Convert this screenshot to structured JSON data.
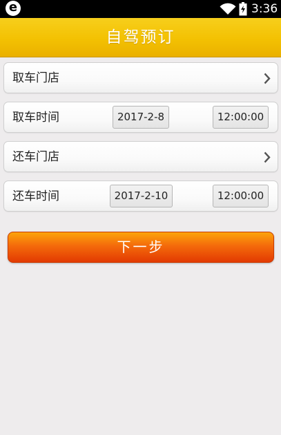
{
  "status_bar": {
    "app_logo": "e",
    "time": "3:36",
    "icons": [
      "wifi-icon",
      "battery-charging-icon"
    ]
  },
  "header": {
    "title": "自驾预订"
  },
  "form": {
    "pickup_store_label": "取车门店",
    "pickup_time_label": "取车时间",
    "pickup_date": "2017-2-8",
    "pickup_clock": "12:00:00",
    "return_store_label": "还车门店",
    "return_time_label": "还车时间",
    "return_date": "2017-2-10",
    "return_clock": "12:00:00"
  },
  "actions": {
    "next_label": "下一步"
  },
  "colors": {
    "header_yellow": "#f3c102",
    "button_orange": "#f46a0b",
    "background": "#eeeced"
  }
}
